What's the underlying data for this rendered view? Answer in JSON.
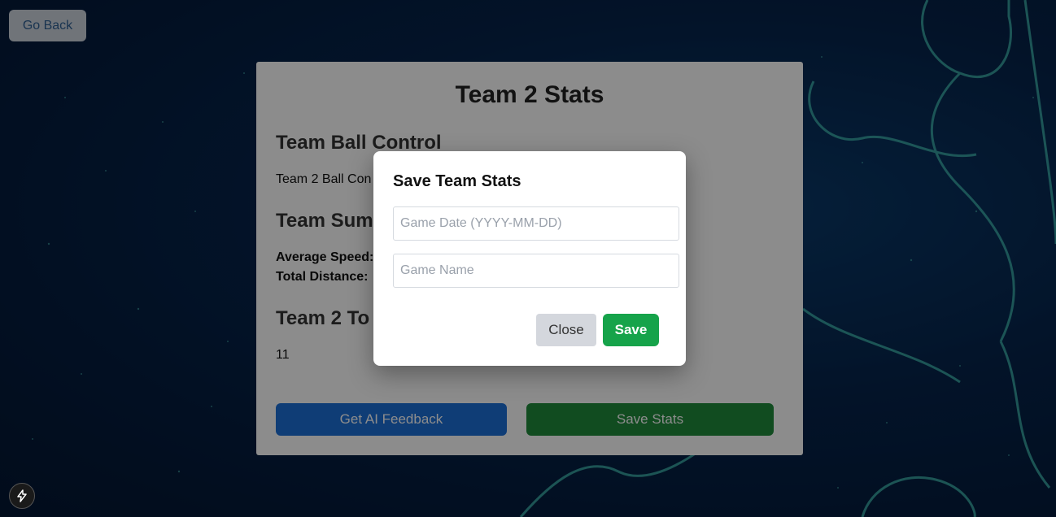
{
  "go_back_label": "Go Back",
  "panel": {
    "title": "Team 2 Stats",
    "ball_control_heading": "Team Ball Control",
    "ball_control_text": "Team 2 Ball Con",
    "summary_heading": "Team Sum",
    "average_speed_label": "Average Speed:",
    "total_distance_label": "Total Distance:",
    "totals_heading": "Team 2 To",
    "totals_value": "11",
    "ai_feedback_label": "Get AI Feedback",
    "save_stats_label": "Save Stats"
  },
  "modal": {
    "title": "Save Team Stats",
    "game_date_placeholder": "Game Date (YYYY-MM-DD)",
    "game_name_placeholder": "Game Name",
    "close_label": "Close",
    "save_label": "Save"
  },
  "colors": {
    "accent_blue": "#1d6fd8",
    "accent_green": "#16a34a",
    "background": "#06234a",
    "art": "#3fb8b0"
  },
  "icons": {
    "dev_indicator": "lightning-bolt-icon"
  }
}
